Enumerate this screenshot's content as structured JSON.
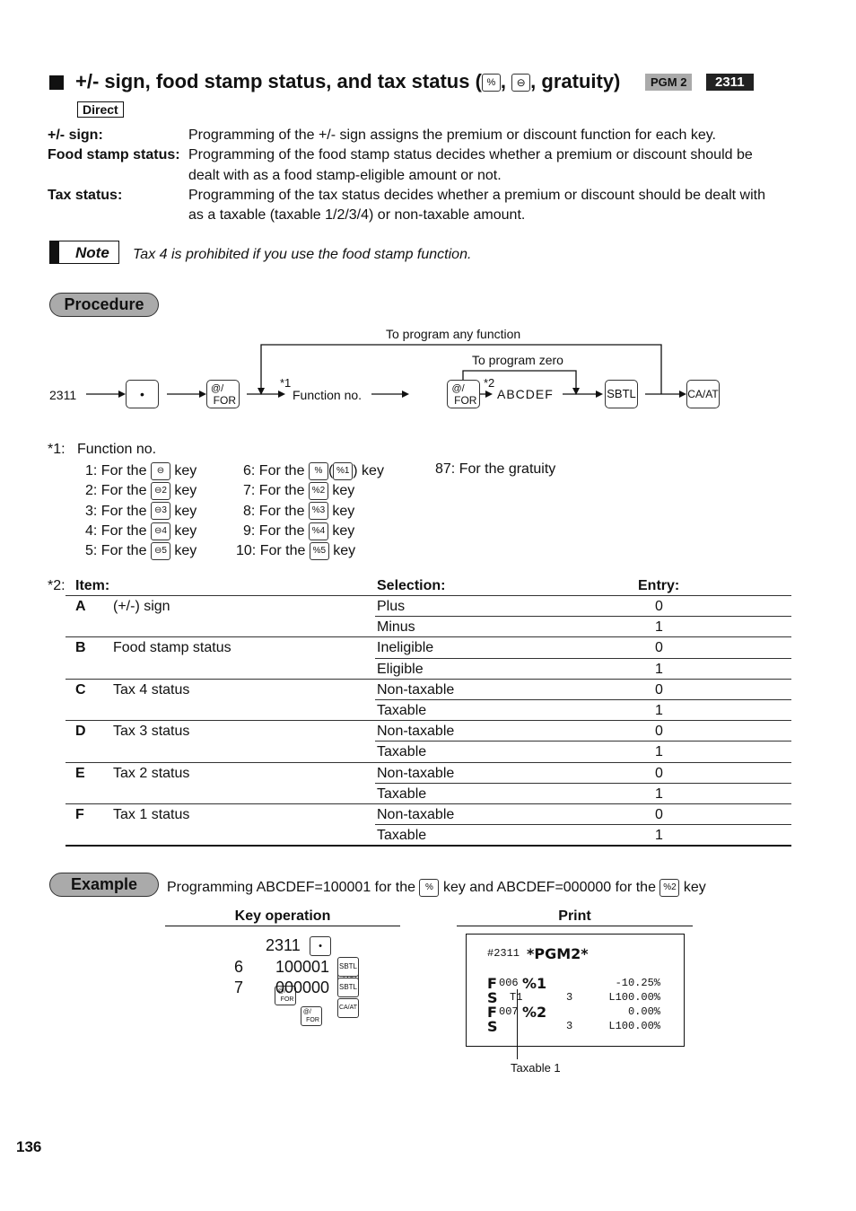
{
  "header": {
    "title_prefix": "+/- sign, food stamp status, and tax status (",
    "title_key1": "%",
    "title_sep": ",",
    "title_key2": "⊖",
    "title_suffix": ", gratuity)",
    "pgm_badge": "PGM 2",
    "code_badge": "2311",
    "direct_badge": "Direct"
  },
  "descriptions": [
    {
      "label": "+/- sign:",
      "text": "Programming of the +/- sign assigns the premium or discount function for each key."
    },
    {
      "label": "Food stamp status:",
      "text": "Programming of the food stamp status decides whether a premium or discount should be",
      "text2": "dealt with as a food stamp-eligible amount or not."
    },
    {
      "label": "Tax status:",
      "text": "Programming of the tax status decides whether a premium or discount should be dealt with",
      "text2": "as a taxable (taxable 1/2/3/4) or non-taxable amount."
    }
  ],
  "note": {
    "label": "Note",
    "text": "Tax 4 is prohibited if you use the food stamp function."
  },
  "procedure": {
    "label": "Procedure",
    "start": "2311",
    "dot_key": "•",
    "for_key_top": "@/",
    "for_key_bottom": "FOR",
    "loop_any_label": "To program any function",
    "loop_zero_label": "To program zero",
    "fn_ref": "*1",
    "fn_label": "Function no.",
    "abc_ref": "*2",
    "abc_label": "ABCDEF",
    "sbtl_key": "SBTL",
    "caat_key": "CA/AT"
  },
  "function_list": {
    "ref": "*1:",
    "title": "Function no.",
    "col1": [
      {
        "num": "1: For the",
        "key": "⊖",
        "suffix": "key"
      },
      {
        "num": "2: For the",
        "key": "⊖2",
        "suffix": "key"
      },
      {
        "num": "3: For the",
        "key": "⊖3",
        "suffix": "key"
      },
      {
        "num": "4: For the",
        "key": "⊖4",
        "suffix": "key"
      },
      {
        "num": "5: For the",
        "key": "⊖5",
        "suffix": "key"
      }
    ],
    "col2": [
      {
        "num": "6: For the",
        "key": "%",
        "alt_key": "%1",
        "suffix": "key"
      },
      {
        "num": "7: For the",
        "key": "%2",
        "suffix": "key"
      },
      {
        "num": "8: For the",
        "key": "%3",
        "suffix": "key"
      },
      {
        "num": "9: For the",
        "key": "%4",
        "suffix": "key"
      },
      {
        "num": "10: For the",
        "key": "%5",
        "suffix": "key"
      }
    ],
    "col3": "87: For the gratuity"
  },
  "item_table": {
    "ref": "*2:",
    "headers": {
      "item": "Item:",
      "selection": "Selection:",
      "entry": "Entry:"
    },
    "rows": [
      {
        "letter": "A",
        "item": "(+/-) sign",
        "options": [
          {
            "sel": "Plus",
            "entry": "0"
          },
          {
            "sel": "Minus",
            "entry": "1"
          }
        ]
      },
      {
        "letter": "B",
        "item": "Food stamp status",
        "options": [
          {
            "sel": "Ineligible",
            "entry": "0"
          },
          {
            "sel": "Eligible",
            "entry": "1"
          }
        ]
      },
      {
        "letter": "C",
        "item": "Tax 4 status",
        "options": [
          {
            "sel": "Non-taxable",
            "entry": "0"
          },
          {
            "sel": "Taxable",
            "entry": "1"
          }
        ]
      },
      {
        "letter": "D",
        "item": "Tax 3 status",
        "options": [
          {
            "sel": "Non-taxable",
            "entry": "0"
          },
          {
            "sel": "Taxable",
            "entry": "1"
          }
        ]
      },
      {
        "letter": "E",
        "item": "Tax 2 status",
        "options": [
          {
            "sel": "Non-taxable",
            "entry": "0"
          },
          {
            "sel": "Taxable",
            "entry": "1"
          }
        ]
      },
      {
        "letter": "F",
        "item": "Tax 1 status",
        "options": [
          {
            "sel": "Non-taxable",
            "entry": "0"
          },
          {
            "sel": "Taxable",
            "entry": "1"
          }
        ]
      }
    ]
  },
  "example": {
    "label": "Example",
    "text1": "Programming ABCDEF=100001 for the",
    "key1": "%",
    "text2": "key and ABCDEF=000000 for the",
    "key2": "%2",
    "text3": "key",
    "key_operation_header": "Key operation",
    "print_header": "Print",
    "ops": {
      "line1_num": "2311",
      "line2_pre": "6",
      "line2_val": "100001",
      "line3_pre": "7",
      "line3_val": "000000"
    },
    "receipt": {
      "line1_a": "#2311",
      "line1_b": "*PGM2*",
      "r1_a": "F",
      "r1_b": "006",
      "r1_c": "%1",
      "r1_val": "-10.25%",
      "r2_a": "S",
      "r2_b": "T1",
      "r2_c": "3",
      "r2_val": "L100.00%",
      "r3_a": "F",
      "r3_b": "007",
      "r3_c": "%2",
      "r3_val": "0.00%",
      "r4_a": "S",
      "r4_c": "3",
      "r4_val": "L100.00%"
    },
    "callout": "Taxable 1"
  },
  "page_number": "136"
}
